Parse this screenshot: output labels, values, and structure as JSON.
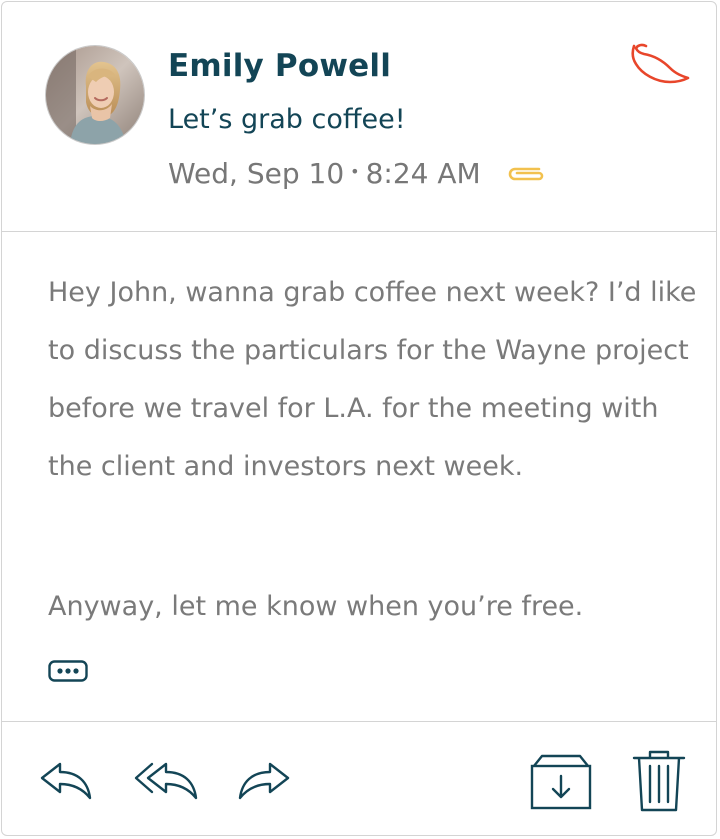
{
  "message": {
    "sender": "Emily Powell",
    "subject": "Let’s grab coffee!",
    "date": "Wed, Sep 10",
    "separator": "•",
    "time": "8:24 AM",
    "body": [
      "Hey John, wanna grab coffee next week? I’d like to discuss the particulars for the Wayne project before we travel for L.A. for the meeting with the client and investors next week.",
      "Anyway, let me know when you’re free."
    ]
  },
  "icons": {
    "priority": "chili-pepper-icon",
    "attachment": "paperclip-icon",
    "more": "ellipsis-icon",
    "reply": "reply-icon",
    "reply_all": "reply-all-icon",
    "forward": "forward-icon",
    "archive": "archive-icon",
    "delete": "trash-icon"
  },
  "colors": {
    "accent": "#134556",
    "body_text": "#7a7a7a",
    "meta_text": "#777777",
    "priority": "#e8462b",
    "attachment": "#f2c14e",
    "divider": "#d4d4d4"
  }
}
